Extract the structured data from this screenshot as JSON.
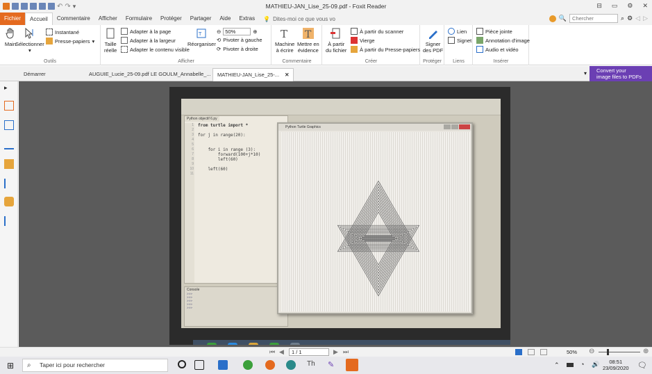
{
  "window": {
    "title": "MATHIEU-JAN_Lise_25-09.pdf - Foxit Reader"
  },
  "ribbon_tabs": [
    "Fichier",
    "Accueil",
    "Commentaire",
    "Afficher",
    "Formulaire",
    "Protéger",
    "Partager",
    "Aide",
    "Extras"
  ],
  "tellme": "Dites-moi ce que vous vo",
  "search": {
    "placeholder": "Chercher"
  },
  "ribbon": {
    "outils": {
      "label": "Outils",
      "main": "Main",
      "select": "Sélectionner",
      "snapshot": "Instantané",
      "clipboard": "Presse-papiers"
    },
    "afficher": {
      "label": "Afficher",
      "taille_l1": "Taille",
      "taille_l2": "réelle",
      "fit_page": "Adapter à la page",
      "fit_width": "Adapter à la largeur",
      "fit_visible": "Adapter le contenu visible",
      "reorg": "Réorganiser",
      "zoom": "50%",
      "rot_left": "Pivoter à gauche",
      "rot_right": "Pivoter à droite"
    },
    "commentaire": {
      "label": "Commentaire",
      "typewriter_l1": "Machine",
      "typewriter_l2": "à écrire",
      "highlight_l1": "Mettre en",
      "highlight_l2": "évidence"
    },
    "creer": {
      "label": "Créer",
      "from_file_l1": "À partir",
      "from_file_l2": "du fichier",
      "scanner": "À partir du scanner",
      "blank": "Vierge",
      "clipboard": "À partir du Presse-papiers"
    },
    "proteger": {
      "label": "Protéger",
      "sign_l1": "Signer",
      "sign_l2": "des PDF"
    },
    "liens": {
      "label": "Liens",
      "link": "Lien",
      "bookmark": "Signet"
    },
    "inserer": {
      "label": "Insérer",
      "attachment": "Pièce jointe",
      "image_annot": "Annotation d'image",
      "audio_video": "Audio et vidéo"
    }
  },
  "doc_tabs": [
    "Démarrer",
    "AUGUIE_Lucie_25-09.pdf",
    "LE GOULM_Annabelle_...",
    "MATHIEU-JAN_Lise_25-..."
  ],
  "convert_banner": {
    "l1": "Convert your",
    "l2": "image files to PDFs"
  },
  "photo": {
    "editor_tab": "Python objectif 6.py",
    "code_lines": [
      "from turtle import *",
      "",
      "for j in range(20):",
      "",
      "",
      "    for i in range (3):",
      "        forward(100+j*10)",
      "        left(60)",
      "",
      "    left(60)"
    ],
    "line_numbers": [
      "1",
      "2",
      "3",
      "4",
      "5",
      "6",
      "7",
      "8",
      "9",
      "10",
      "11"
    ],
    "console_label": "Console",
    "turtle_title": "Python Turtle Graphics"
  },
  "status": {
    "page": "1 / 1",
    "zoom": "50%"
  },
  "taskbar": {
    "search": "Taper ici pour rechercher",
    "time": "08:51",
    "date": "23/09/2020"
  }
}
